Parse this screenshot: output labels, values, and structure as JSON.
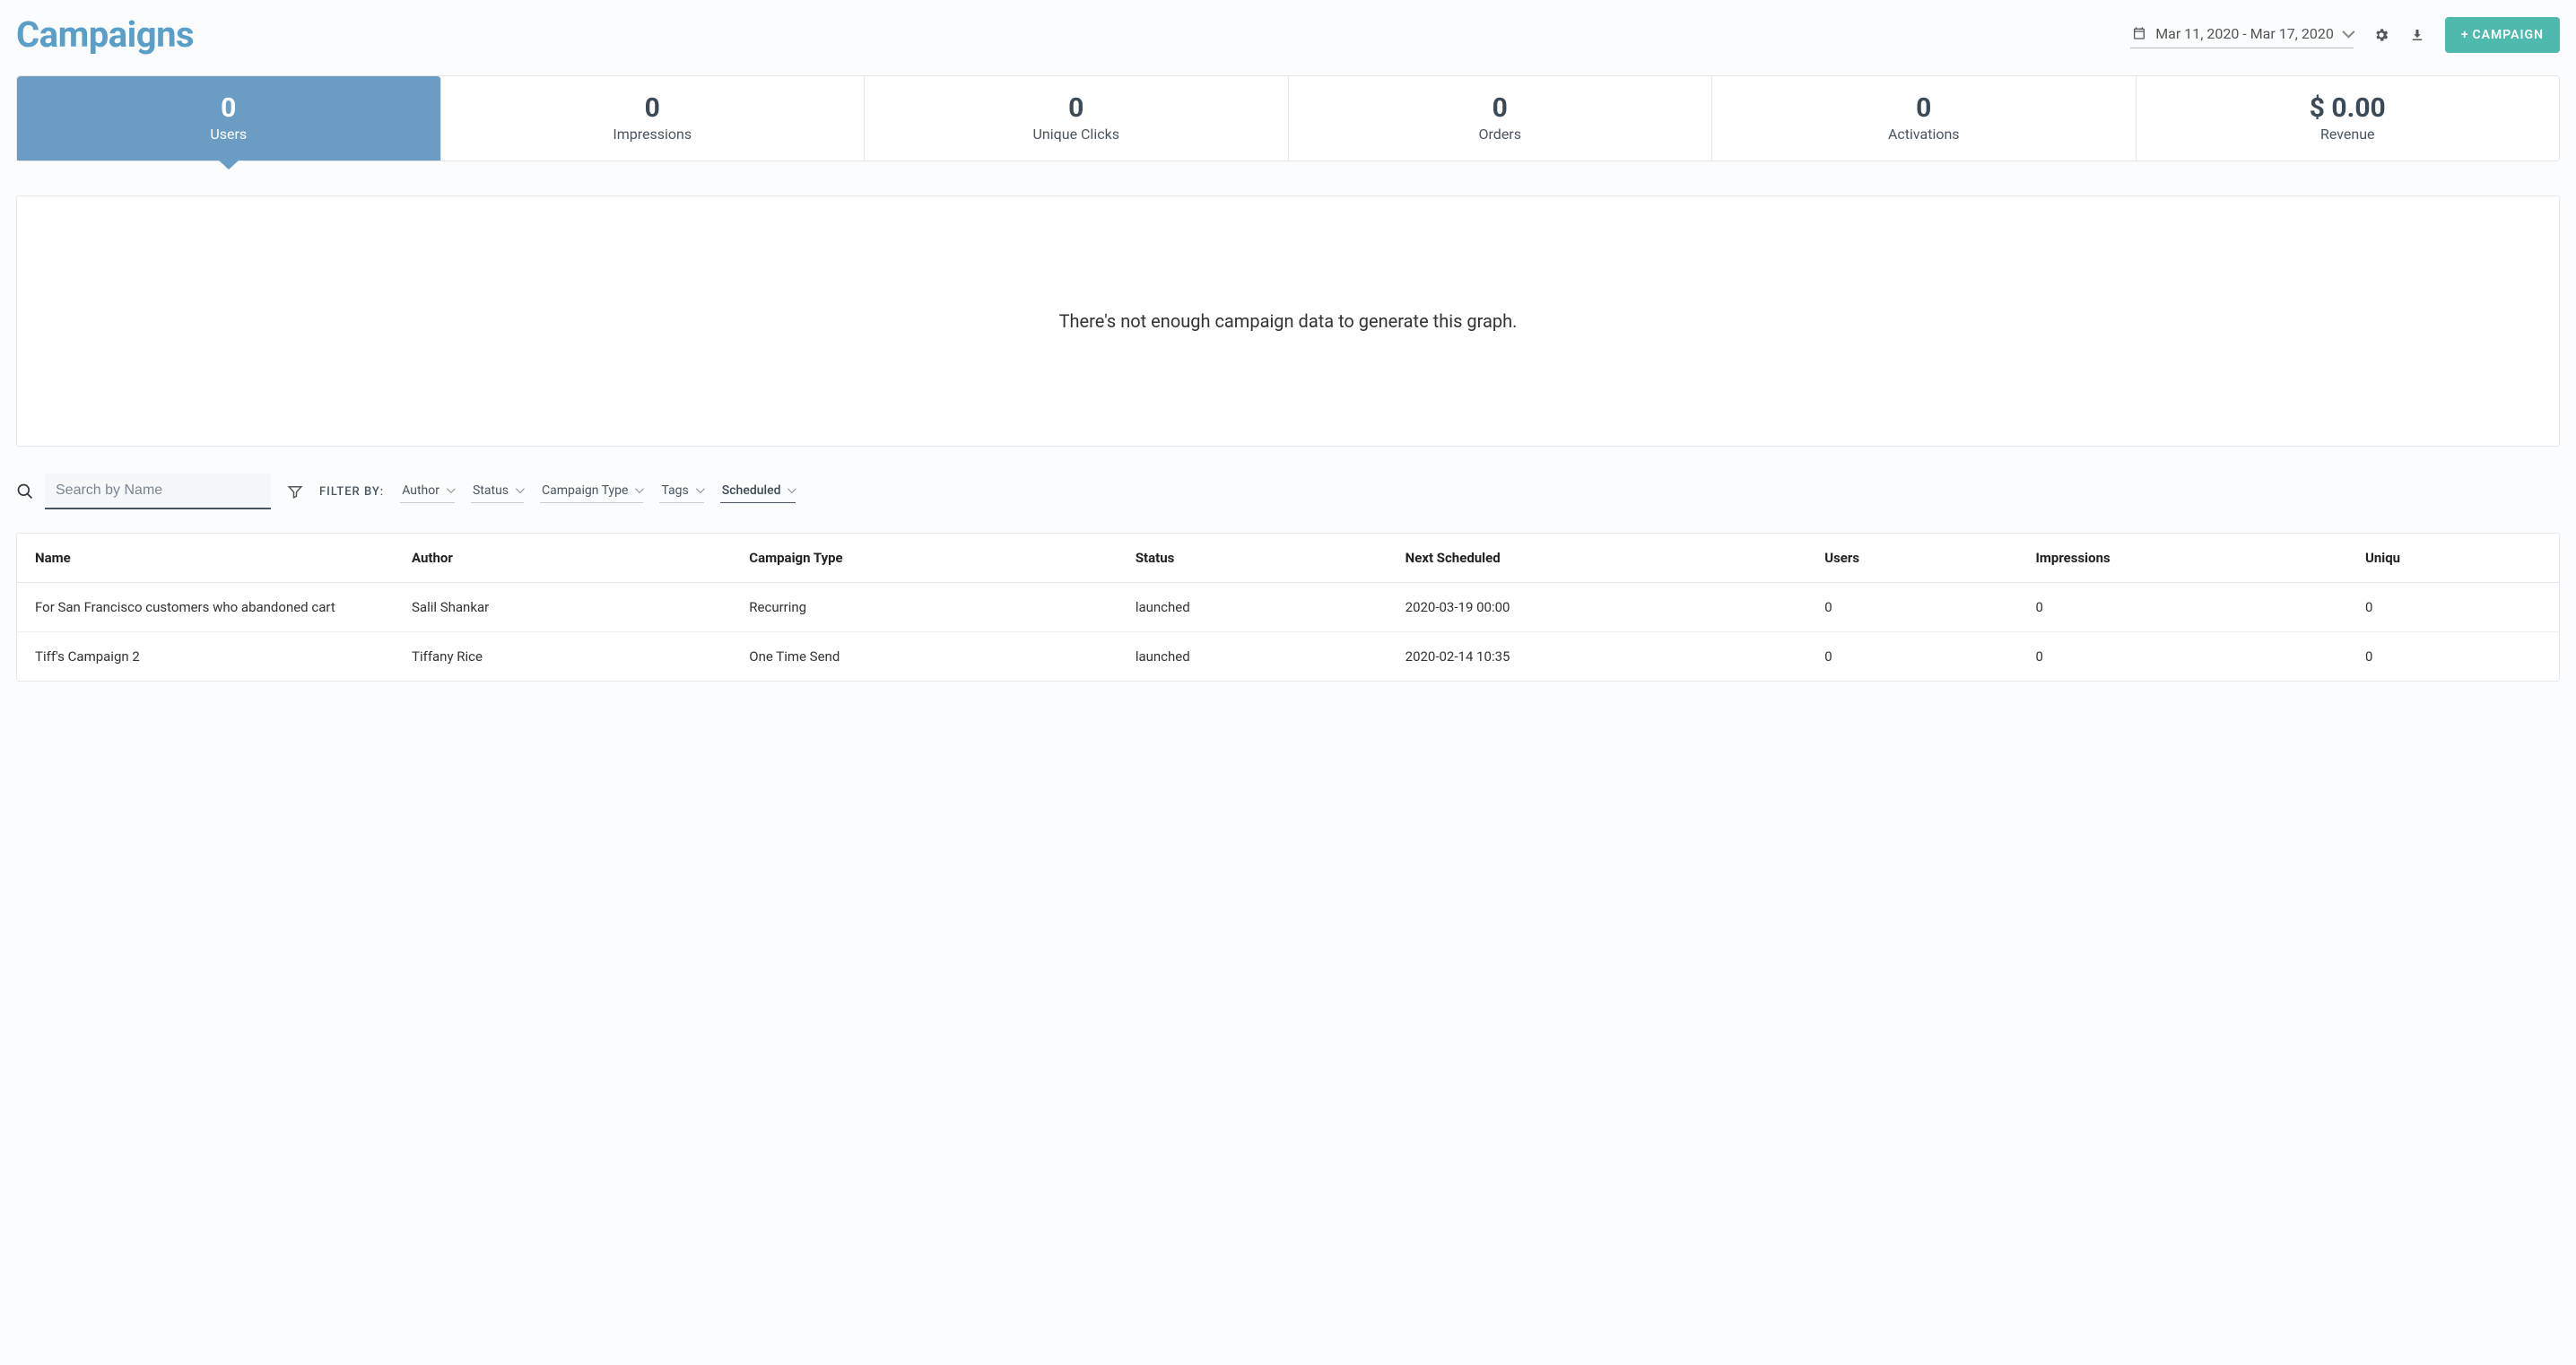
{
  "header": {
    "title": "Campaigns",
    "date_range": "Mar 11, 2020 - Mar 17, 2020",
    "new_button": "CAMPAIGN"
  },
  "stats": [
    {
      "value": "0",
      "label": "Users",
      "active": true
    },
    {
      "value": "0",
      "label": "Impressions",
      "active": false
    },
    {
      "value": "0",
      "label": "Unique Clicks",
      "active": false
    },
    {
      "value": "0",
      "label": "Orders",
      "active": false
    },
    {
      "value": "0",
      "label": "Activations",
      "active": false
    },
    {
      "value": "$ 0.00",
      "label": "Revenue",
      "active": false
    }
  ],
  "graph": {
    "empty_message": "There's not enough campaign data to generate this graph."
  },
  "search": {
    "placeholder": "Search by Name"
  },
  "filters": {
    "label": "FILTER BY:",
    "items": [
      {
        "label": "Author",
        "active": false
      },
      {
        "label": "Status",
        "active": false
      },
      {
        "label": "Campaign Type",
        "active": false
      },
      {
        "label": "Tags",
        "active": false
      },
      {
        "label": "Scheduled",
        "active": true
      }
    ]
  },
  "table": {
    "columns": [
      "Name",
      "Author",
      "Campaign Type",
      "Status",
      "Next Scheduled",
      "Users",
      "Impressions",
      "Uniqu"
    ],
    "rows": [
      {
        "name": "For San Francisco customers who abandoned cart",
        "author": "Salil Shankar",
        "campaign_type": "Recurring",
        "status": "launched",
        "next_scheduled": "2020-03-19 00:00",
        "users": "0",
        "impressions": "0",
        "unique": "0"
      },
      {
        "name": "Tiff's Campaign 2",
        "author": "Tiffany Rice",
        "campaign_type": "One Time Send",
        "status": "launched",
        "next_scheduled": "2020-02-14 10:35",
        "users": "0",
        "impressions": "0",
        "unique": "0"
      }
    ]
  }
}
